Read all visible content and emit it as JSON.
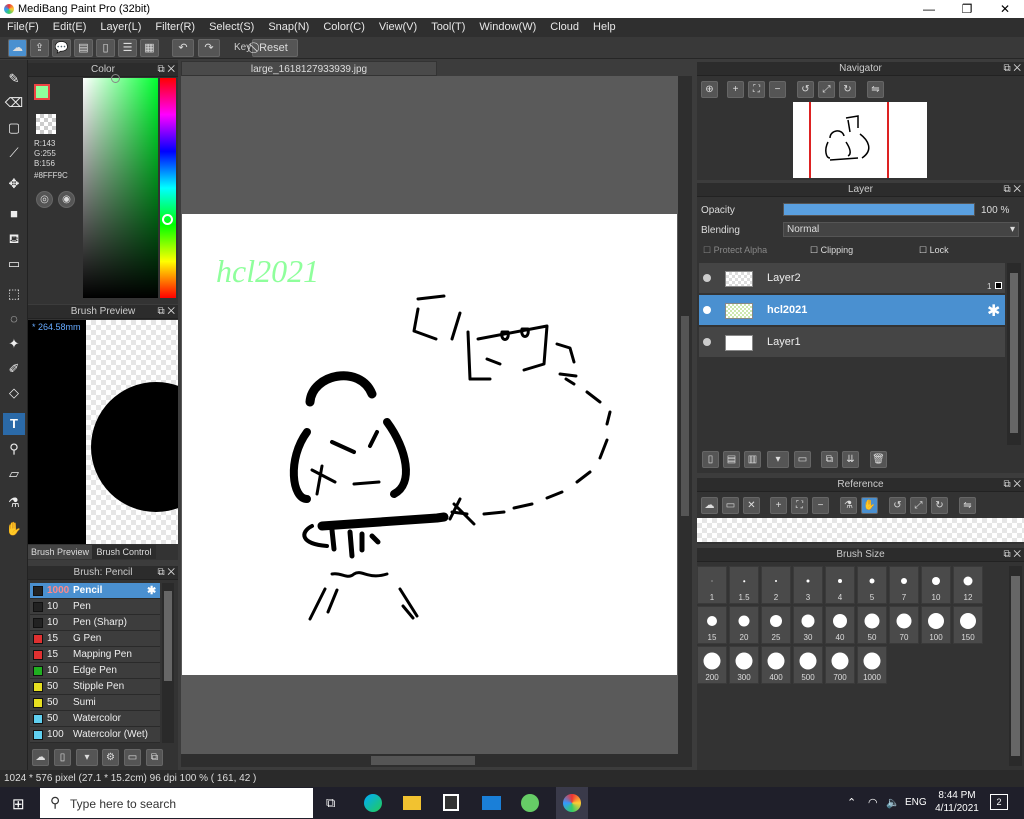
{
  "window": {
    "title": "MediBang Paint Pro (32bit)",
    "minimize": "—",
    "maximize": "❐",
    "close": "✕"
  },
  "menu": [
    "File(F)",
    "Edit(E)",
    "Layer(L)",
    "Filter(R)",
    "Select(S)",
    "Snap(N)",
    "Color(C)",
    "View(V)",
    "Tool(T)",
    "Window(W)",
    "Cloud",
    "Help"
  ],
  "toolbar": {
    "key_label": "Key",
    "reset_label": "Reset"
  },
  "color_panel": {
    "title": "Color",
    "rgb_r": "R:143",
    "rgb_g": "G:255",
    "rgb_b": "B:156",
    "hex": "#8FFF9C",
    "fg_color": "#8FFF9C"
  },
  "brush_preview": {
    "title": "Brush Preview",
    "size": "* 264.58mm",
    "tab1": "Brush Preview",
    "tab2": "Brush Control"
  },
  "brush_panel": {
    "title": "Brush: Pencil",
    "items": [
      {
        "size": "1000",
        "name": "Pencil",
        "color": "#222222"
      },
      {
        "size": "10",
        "name": "Pen",
        "color": "#222222"
      },
      {
        "size": "10",
        "name": "Pen (Sharp)",
        "color": "#222222"
      },
      {
        "size": "15",
        "name": "G Pen",
        "color": "#e03030"
      },
      {
        "size": "15",
        "name": "Mapping Pen",
        "color": "#e03030"
      },
      {
        "size": "10",
        "name": "Edge Pen",
        "color": "#20b020"
      },
      {
        "size": "50",
        "name": "Stipple Pen",
        "color": "#e8e020"
      },
      {
        "size": "50",
        "name": "Sumi",
        "color": "#e8e020"
      },
      {
        "size": "50",
        "name": "Watercolor",
        "color": "#60d0f0"
      },
      {
        "size": "100",
        "name": "Watercolor (Wet)",
        "color": "#60d0f0"
      }
    ]
  },
  "document": {
    "tab": "large_1618127933939.jpg",
    "canvas_text": "hcl2021"
  },
  "navigator": {
    "title": "Navigator"
  },
  "layer_panel": {
    "title": "Layer",
    "opacity_label": "Opacity",
    "opacity_value": "100 %",
    "opacity_fraction": 1.0,
    "blending_label": "Blending",
    "blending_value": "Normal",
    "protect_alpha": "Protect Alpha",
    "clipping": "Clipping",
    "lock": "Lock",
    "layers": [
      {
        "name": "Layer2",
        "badge": "1"
      },
      {
        "name": "hcl2021",
        "badge": ""
      },
      {
        "name": "Layer1",
        "badge": ""
      }
    ]
  },
  "reference": {
    "title": "Reference"
  },
  "brush_size": {
    "title": "Brush Size",
    "sizes": [
      "1",
      "1.5",
      "2",
      "3",
      "4",
      "5",
      "7",
      "10",
      "12",
      "15",
      "20",
      "25",
      "30",
      "40",
      "50",
      "70",
      "100",
      "150",
      "200",
      "300",
      "400",
      "500",
      "700",
      "1000"
    ]
  },
  "status": {
    "text": "1024 * 576 pixel  (27.1 * 15.2cm)  96 dpi  100 %  ( 161, 42 )"
  },
  "taskbar": {
    "search_placeholder": "Type here to search",
    "lang": "ENG",
    "time": "8:44 PM",
    "date": "4/11/2021",
    "notif": "2"
  }
}
